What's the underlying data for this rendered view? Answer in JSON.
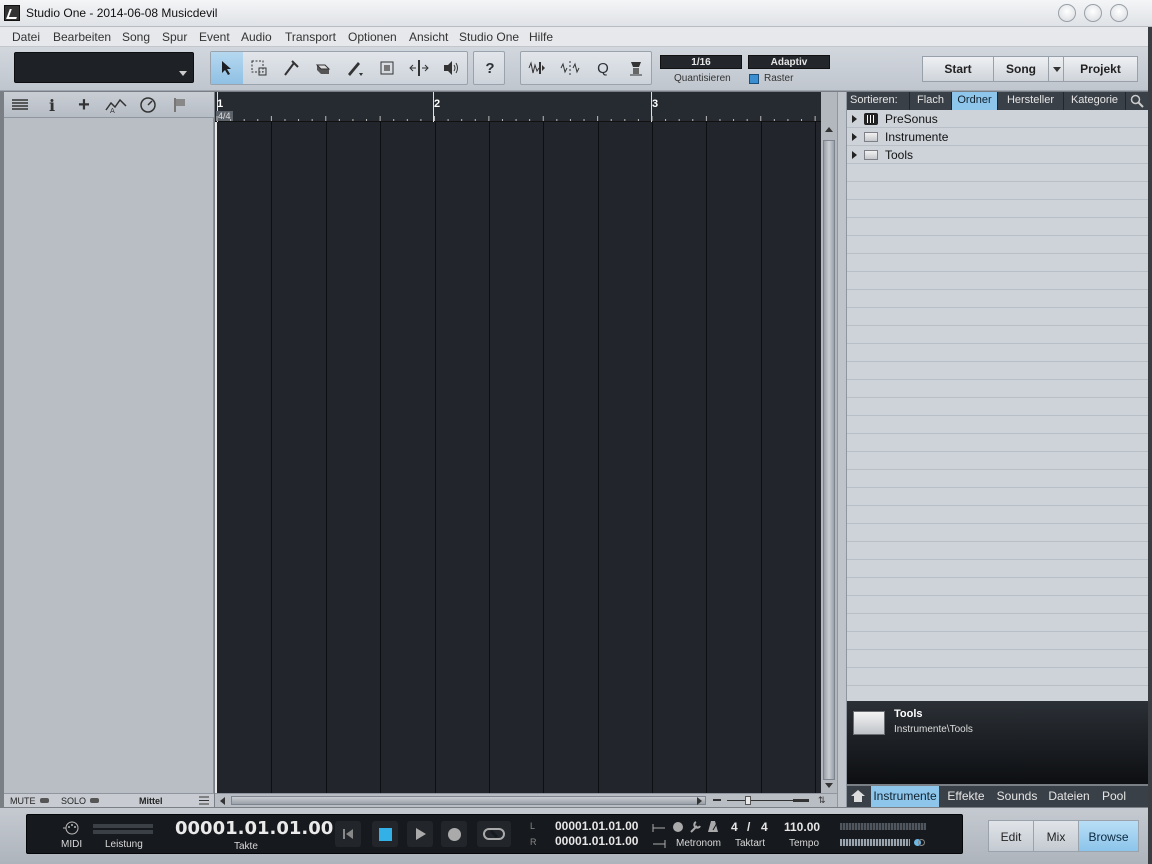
{
  "window": {
    "title": "Studio One - 2014-06-08 Musicdevil"
  },
  "menu": [
    "Datei",
    "Bearbeiten",
    "Song",
    "Spur",
    "Event",
    "Audio",
    "Transport",
    "Optionen",
    "Ansicht",
    "Studio One",
    "Hilfe"
  ],
  "toolbar": {
    "tools": [
      "arrow-tool",
      "range-tool",
      "split-tool",
      "eraser-tool",
      "paint-tool",
      "mute-tool",
      "bend-tool",
      "listen-tool"
    ],
    "help": "?",
    "quantize_value": "1/16",
    "quantize_label": "Quantisieren",
    "snap_value": "Adaptiv",
    "snap_label": "Raster",
    "nav": {
      "start": "Start",
      "song": "Song",
      "project": "Projekt"
    }
  },
  "ruler": {
    "bars": [
      "1",
      "2",
      "3"
    ],
    "time_signature": "4/4"
  },
  "track_footer": {
    "mute": "MUTE",
    "solo": "SOLO",
    "size": "Mittel"
  },
  "browser": {
    "sort_label": "Sortieren:",
    "sort_tabs": [
      "Flach",
      "Ordner",
      "Hersteller",
      "Kategorie"
    ],
    "active_sort": "Ordner",
    "items": [
      "PreSonus",
      "Instrumente",
      "Tools"
    ],
    "info": {
      "title": "Tools",
      "path": "Instrumente\\Tools"
    },
    "bottom_tabs": [
      "Instrumente",
      "Effekte",
      "Sounds",
      "Dateien",
      "Pool"
    ],
    "active_bottom": "Instrumente"
  },
  "transport": {
    "midi_label": "MIDI",
    "performance_label": "Leistung",
    "position": "00001.01.01.00",
    "position_label": "Takte",
    "loop_left": "00001.01.01.00",
    "loop_right": "00001.01.01.00",
    "loop_l": "L",
    "loop_r": "R",
    "metronome_label": "Metronom",
    "time_signature_num": "4",
    "time_signature_sep": "/",
    "time_signature_den": "4",
    "time_signature_label": "Taktart",
    "tempo": "110.00",
    "tempo_label": "Tempo"
  },
  "modes": [
    "Edit",
    "Mix",
    "Browse"
  ],
  "active_mode": "Browse",
  "colors": {
    "accent": "#8ec5ea",
    "arrange_bg": "#22262c",
    "panel": "#ced3d9"
  }
}
